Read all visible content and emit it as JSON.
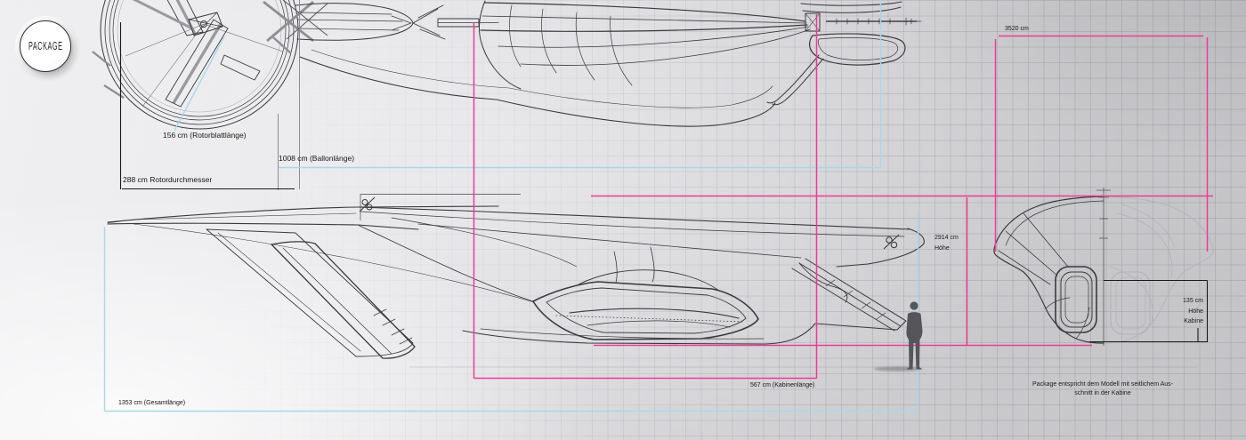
{
  "badge": {
    "label": "PACKAGE"
  },
  "labels": {
    "rotor_blade_length": "156 cm (Rotorblattlänge)",
    "balloon_length": "1008 cm (Ballonlänge)",
    "rotor_diameter": "288 cm Rotordurchmesser",
    "top_width": "3520 cm",
    "total_height_value": "2914 cm",
    "total_height_word": "Höhe",
    "cabin_height_value": "135 cm",
    "cabin_height_word1": "Höhe",
    "cabin_height_word2": "Kabine",
    "cabin_length": "567 cm (Kabinenlänge)",
    "total_length": "1353 cm (Gesamtlänge)",
    "note_line1": "Package entspricht dem Modell mit seitlichem Aus-",
    "note_line2": "schnitt in der Kabine"
  },
  "colors": {
    "pink": "#ee3a99",
    "blue": "#a9d7ea",
    "ink": "#1a1a1a"
  }
}
